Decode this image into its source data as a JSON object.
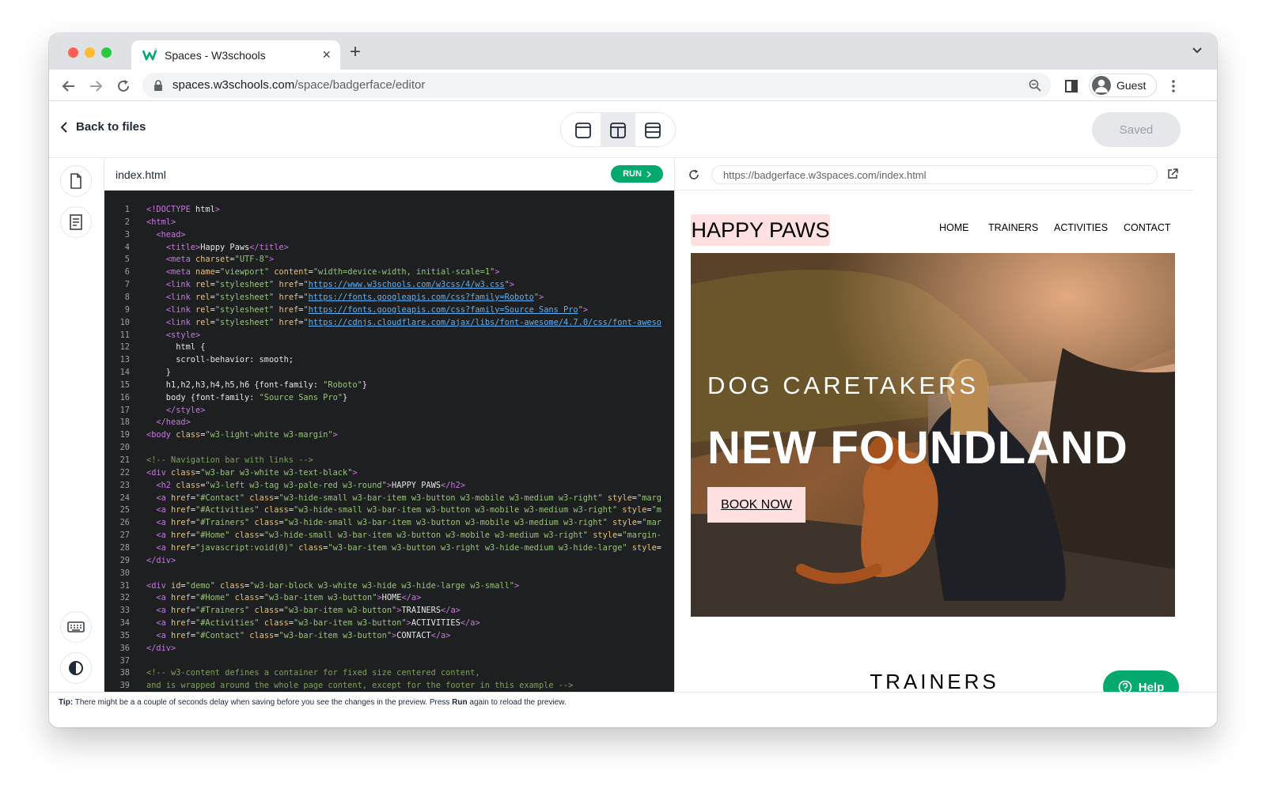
{
  "browser": {
    "tab_title": "Spaces - W3schools",
    "url_host": "spaces.w3schools.com",
    "url_path": "/space/badgerface/editor",
    "profile_label": "Guest"
  },
  "app": {
    "back_label": "Back to files",
    "saved_label": "Saved",
    "file_name": "index.html",
    "run_label": "RUN",
    "preview_url": "https://badgerface.w3spaces.com/index.html",
    "help_label": "Help",
    "tip_prefix": "Tip:",
    "tip_text_1": " There might be a a couple of seconds delay when saving before you see the changes in the preview. Press ",
    "tip_run": "Run",
    "tip_text_2": " again to reload the preview."
  },
  "code_lines": [
    "<!DOCTYPE html>",
    "<html>",
    "  <head>",
    "    <title>Happy Paws</title>",
    "    <meta charset=\"UTF-8\">",
    "    <meta name=\"viewport\" content=\"width=device-width, initial-scale=1\">",
    "    <link rel=\"stylesheet\" href=\"https://www.w3schools.com/w3css/4/w3.css\">",
    "    <link rel=\"stylesheet\" href=\"https://fonts.googleapis.com/css?family=Roboto\">",
    "    <link rel=\"stylesheet\" href=\"https://fonts.googleapis.com/css?family=Source Sans Pro\">",
    "    <link rel=\"stylesheet\" href=\"https://cdnjs.cloudflare.com/ajax/libs/font-awesome/4.7.0/css/font-aweso",
    "    <style>",
    "      html {",
    "      scroll-behavior: smooth;",
    "    }",
    "    h1,h2,h3,h4,h5,h6 {font-family: \"Roboto\"}",
    "    body {font-family: \"Source Sans Pro\"}",
    "    </style>",
    "  </head>",
    "<body class=\"w3-light-white w3-margin\">",
    "",
    "<!-- Navigation bar with links -->",
    "<div class=\"w3-bar w3-white w3-text-black\">",
    "  <h2 class=\"w3-left w3-tag w3-pale-red w3-round\">HAPPY PAWS</h2>",
    "  <a href=\"#Contact\" class=\"w3-hide-small w3-bar-item w3-button w3-mobile w3-medium w3-right\" style=\"marg",
    "  <a href=\"#Activities\" class=\"w3-hide-small w3-bar-item w3-button w3-mobile w3-medium w3-right\" style=\"m",
    "  <a href=\"#Trainers\" class=\"w3-hide-small w3-bar-item w3-button w3-mobile w3-medium w3-right\" style=\"mar",
    "  <a href=\"#Home\" class=\"w3-hide-small w3-bar-item w3-button w3-mobile w3-medium w3-right\" style=\"margin-",
    "  <a href=\"javascript:void(0)\" class=\"w3-bar-item w3-button w3-right w3-hide-medium w3-hide-large\" style=",
    "</div>",
    "",
    "<div id=\"demo\" class=\"w3-bar-block w3-white w3-hide w3-hide-large w3-small\">",
    "  <a href=\"#Home\" class=\"w3-bar-item w3-button\">HOME</a>",
    "  <a href=\"#Trainers\" class=\"w3-bar-item w3-button\">TRAINERS</a>",
    "  <a href=\"#Activities\" class=\"w3-bar-item w3-button\">ACTIVITIES</a>",
    "  <a href=\"#Contact\" class=\"w3-bar-item w3-button\">CONTACT</a>",
    "</div>",
    "",
    "<!-- w3-content defines a container for fixed size centered content,",
    "and is wrapped around the whole page content, except for the footer in this example -->"
  ],
  "site": {
    "logo": "HAPPY PAWS",
    "nav": [
      "HOME",
      "TRAINERS",
      "ACTIVITIES",
      "CONTACT"
    ],
    "hero_subtitle": "DOG CARETAKERS",
    "hero_title": "NEW FOUNDLAND",
    "cta": "BOOK NOW",
    "section_heading": "TRAINERS"
  },
  "colors": {
    "accent_green": "#04aa6d",
    "pale_red": "#ffe0e0",
    "editor_bg": "#1d1f21"
  },
  "icons": [
    "back-arrow-icon",
    "forward-arrow-icon",
    "reload-icon",
    "lock-icon",
    "zoom-icon",
    "sidepanel-icon",
    "kebab-menu-icon",
    "file-icon",
    "notebook-icon",
    "keyboard-icon",
    "contrast-icon",
    "external-link-icon",
    "help-icon"
  ]
}
